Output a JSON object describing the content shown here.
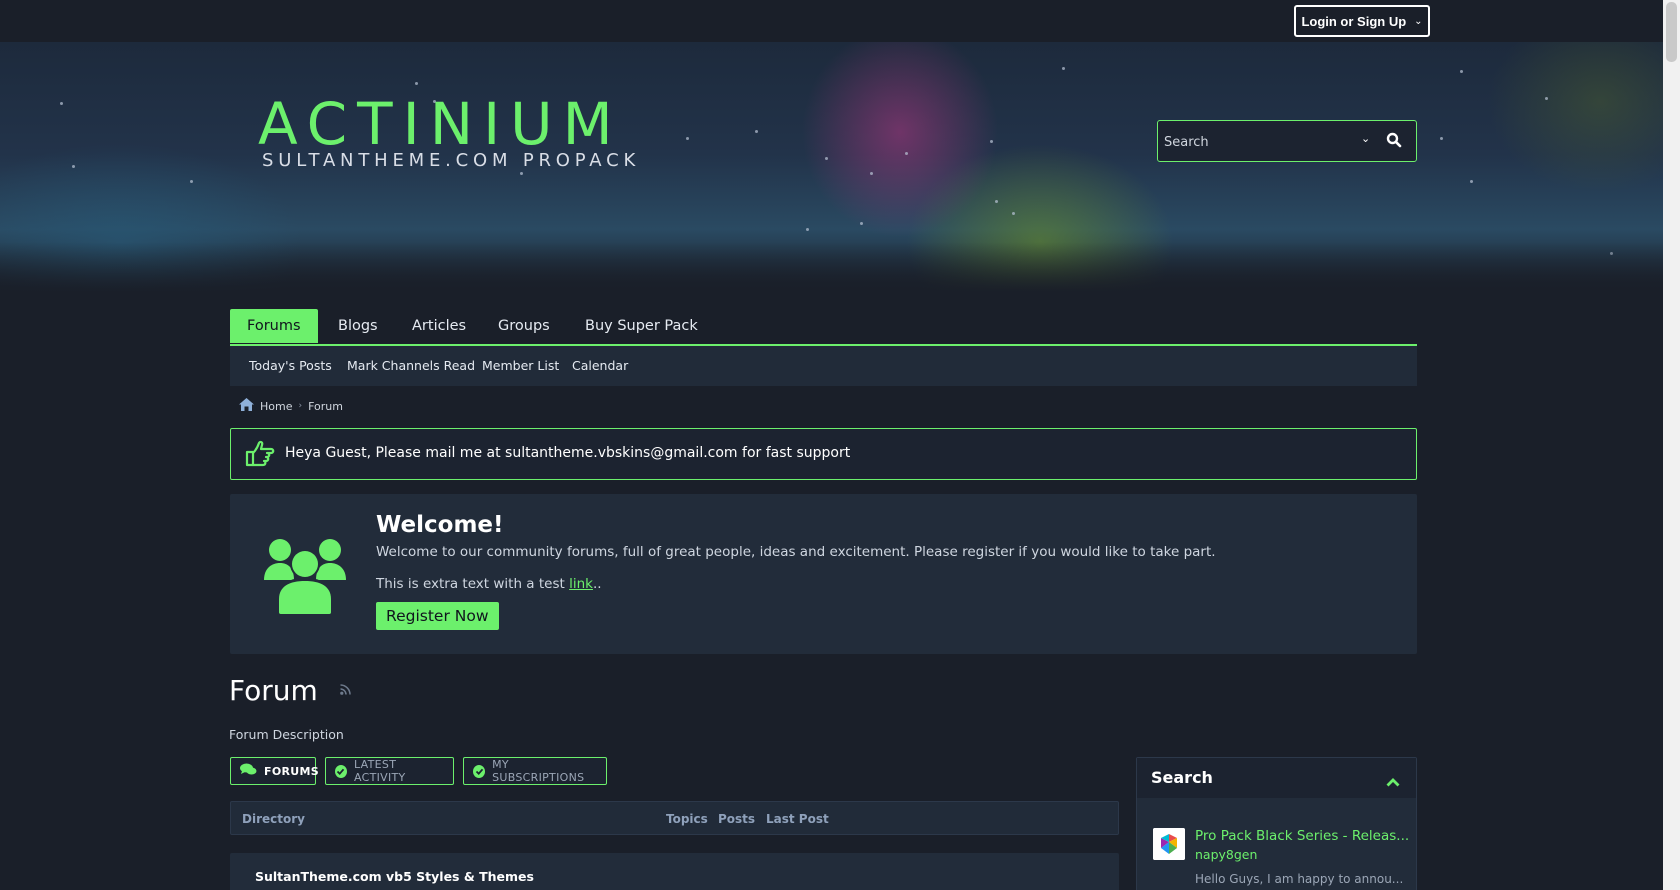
{
  "top_bar": {
    "login_label": "Login or Sign Up"
  },
  "header": {
    "logo_title": "ACTINIUM",
    "logo_subtitle": "SULTANTHEME.COM PROPACK",
    "search_placeholder": "Search"
  },
  "nav": {
    "tabs": [
      {
        "label": "Forums",
        "active": true
      },
      {
        "label": "Blogs",
        "active": false
      },
      {
        "label": "Articles",
        "active": false
      },
      {
        "label": "Groups",
        "active": false
      },
      {
        "label": "Buy Super Pack",
        "active": false
      }
    ],
    "subnav": [
      "Today's Posts",
      "Mark Channels Read",
      "Member List",
      "Calendar"
    ]
  },
  "breadcrumb": {
    "home": "Home",
    "current": "Forum"
  },
  "notice": {
    "text": "Heya Guest, Please mail me at sultantheme.vbskins@gmail.com for fast support"
  },
  "welcome": {
    "title": "Welcome!",
    "text": "Welcome to our community forums, full of great people, ideas and excitement. Please register if you would like to take part.",
    "extra_prefix": "This is extra text with a test ",
    "extra_link": "link",
    "extra_suffix": "..",
    "register_label": "Register Now"
  },
  "forum": {
    "title": "Forum",
    "description": "Forum Description",
    "tabs": [
      {
        "label": "FORUMS",
        "active": true
      },
      {
        "label": "LATEST ACTIVITY",
        "active": false
      },
      {
        "label": "MY SUBSCRIPTIONS",
        "active": false
      }
    ],
    "columns": [
      "Directory",
      "Topics",
      "Posts",
      "Last Post"
    ],
    "first_channel": "SultanTheme.com vb5 Styles & Themes"
  },
  "sidebar": {
    "title": "Search",
    "item": {
      "title": "Pro Pack Black Series - Releas...",
      "author": "napy8gen",
      "excerpt": "Hello Guys, I am happy to annou..."
    }
  },
  "colors": {
    "accent": "#6cf06c",
    "background": "#1a1f29",
    "panel": "#222c3a",
    "subnav": "#212b39"
  }
}
